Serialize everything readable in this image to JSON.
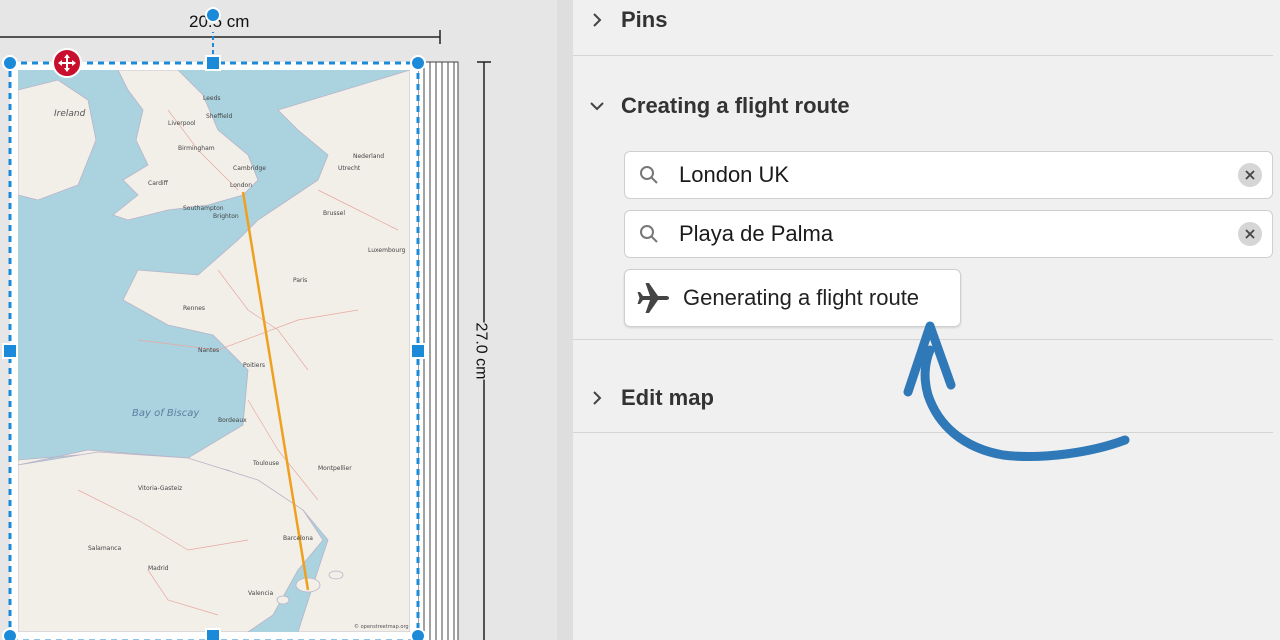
{
  "canvas": {
    "width_label": "20.5 cm",
    "height_label": "27.0 cm",
    "map": {
      "water_label": "Bay of Biscay",
      "country_label": "Ireland",
      "cities": [
        "Ireland",
        "Leeds",
        "Sheffield",
        "Liverpool",
        "Birmingham",
        "Cambridge",
        "Cardiff",
        "London",
        "Southampton",
        "Brighton",
        "Nederland",
        "Utrecht",
        "Brussel",
        "Luxembourg",
        "Rennes",
        "Nantes",
        "Paris",
        "Poitiers",
        "Bordeaux",
        "Toulouse",
        "Montpellier",
        "Vitoria-Gasteiz",
        "Madrid",
        "Barcelona",
        "Salamanca",
        "Valencia"
      ],
      "attribution": "© openstreetmap.org"
    },
    "route": {
      "from": "London",
      "to": "Playa de Palma",
      "color": "#f0a020"
    }
  },
  "panel": {
    "sections": {
      "pins": {
        "title": "Pins"
      },
      "flight": {
        "title": "Creating a flight route"
      },
      "edit": {
        "title": "Edit map"
      }
    },
    "search_from": {
      "value": "London UK",
      "icon": "search-icon"
    },
    "search_to": {
      "value": "Playa de Palma",
      "icon": "search-icon"
    },
    "generate_button": {
      "label": "Generating a flight route",
      "icon": "airplane-icon"
    },
    "annotation": {
      "color": "#2f79b8",
      "icon": "hand-drawn-arrow"
    }
  },
  "colors": {
    "selection": "#1b8ad9",
    "move_handle": "#c8102e",
    "water": "#aad3df",
    "land": "#f2efe9"
  }
}
